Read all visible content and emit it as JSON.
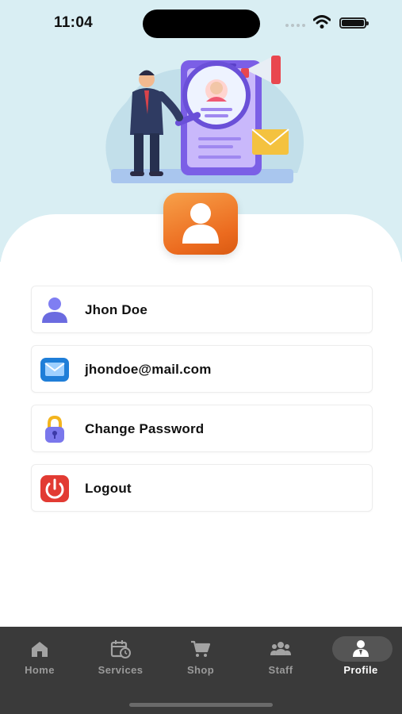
{
  "status_bar": {
    "time": "11:04"
  },
  "profile": {
    "items": [
      {
        "label": "Jhon Doe",
        "icon": "user-icon"
      },
      {
        "label": "jhondoe@mail.com",
        "icon": "mail-icon"
      },
      {
        "label": "Change Password",
        "icon": "lock-icon"
      },
      {
        "label": "Logout",
        "icon": "power-icon"
      }
    ]
  },
  "tabbar": {
    "tabs": [
      {
        "label": "Home",
        "icon": "home-icon"
      },
      {
        "label": "Services",
        "icon": "calendar-clock-icon"
      },
      {
        "label": "Shop",
        "icon": "cart-icon"
      },
      {
        "label": "Staff",
        "icon": "group-icon"
      },
      {
        "label": "Profile",
        "icon": "person-badge-icon",
        "active": true
      }
    ]
  },
  "colors": {
    "hero_bg": "#d9eef3",
    "avatar_tile": "#ec6b1f",
    "tabbar_bg": "#3a3a3a",
    "tab_active": "#ffffff",
    "tab_inactive": "#9a9a9a"
  }
}
